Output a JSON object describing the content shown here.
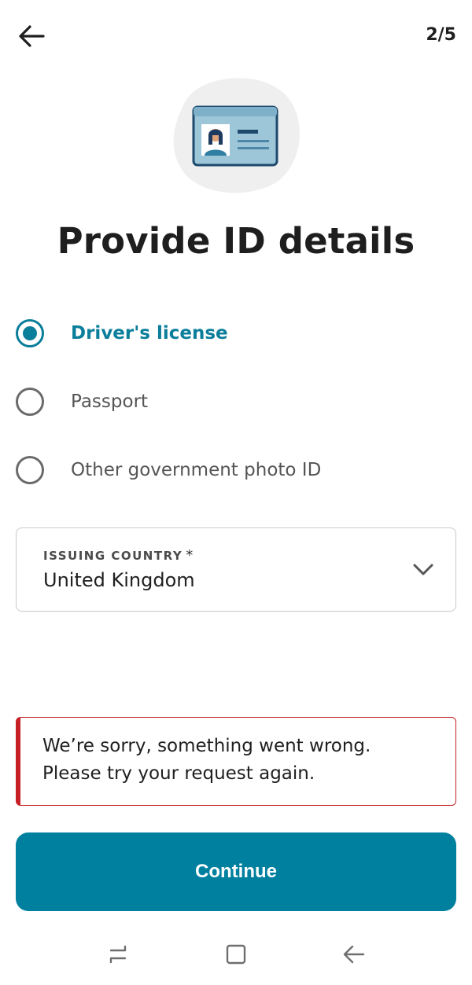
{
  "header": {
    "step": "2/5"
  },
  "title": "Provide ID details",
  "id_options": [
    {
      "label": "Driver's license",
      "selected": true
    },
    {
      "label": "Passport",
      "selected": false
    },
    {
      "label": "Other government photo ID",
      "selected": false
    }
  ],
  "issuing_country": {
    "label": "ISSUING COUNTRY",
    "required_mark": "*",
    "value": "United Kingdom"
  },
  "error": {
    "line1": "We’re sorry, something went wrong.",
    "line2": "Please try your request again."
  },
  "continue_label": "Continue",
  "colors": {
    "accent": "#0a7e9a",
    "button": "#00809f",
    "error": "#c62026"
  },
  "icons": {
    "back": "back-arrow-icon",
    "chevron": "chevron-down-icon",
    "illustration": "id-card-icon"
  }
}
